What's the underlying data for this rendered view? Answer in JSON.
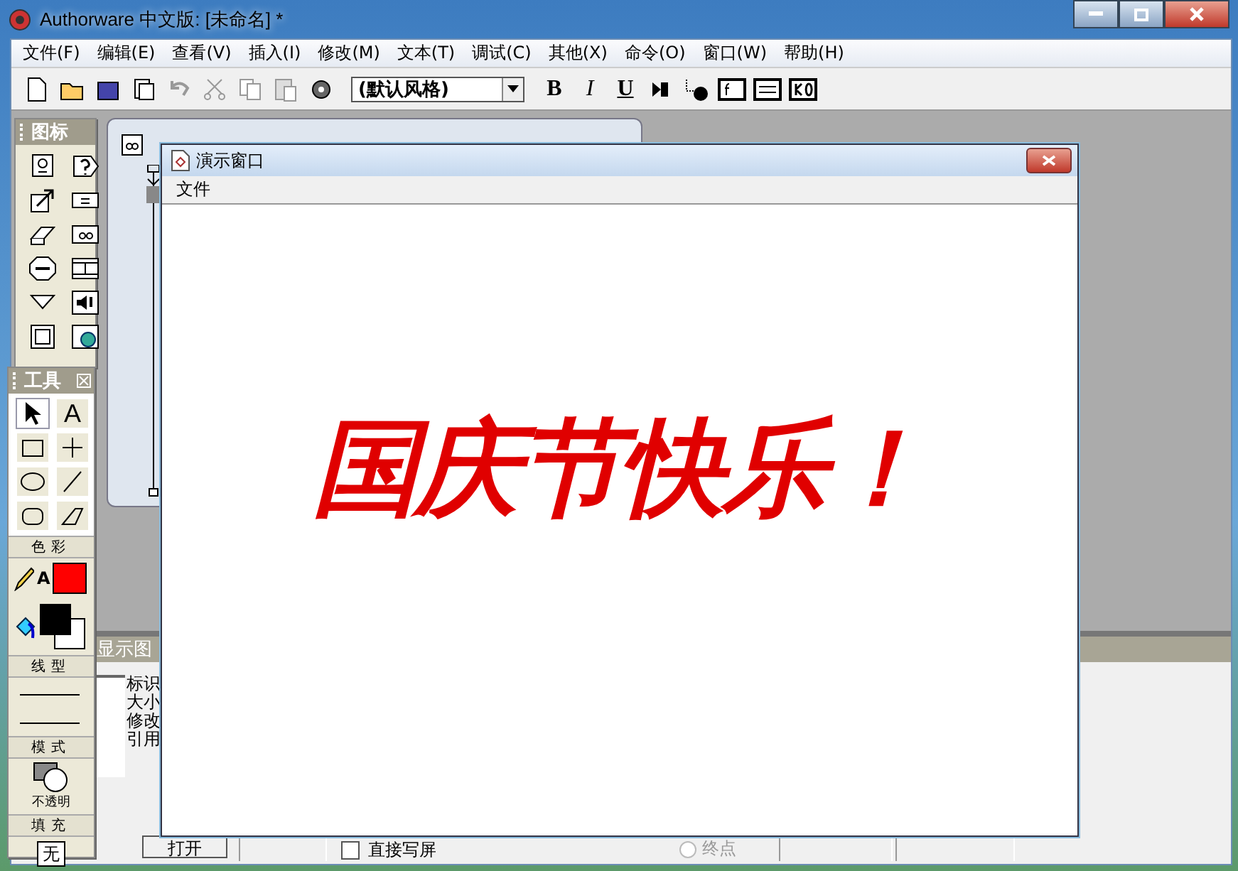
{
  "app_window": {
    "title": "Authorware 中文版: [未命名] *"
  },
  "menu": [
    "文件(F)",
    "编辑(E)",
    "查看(V)",
    "插入(I)",
    "修改(M)",
    "文本(T)",
    "调试(C)",
    "其他(X)",
    "命令(O)",
    "窗口(W)",
    "帮助(H)"
  ],
  "toolbar": {
    "style_dropdown": "(默认风格)",
    "format_buttons": [
      "B",
      "I",
      "U"
    ]
  },
  "icon_palette": {
    "title": "图标"
  },
  "tools_palette": {
    "title": "工具",
    "tools": [
      {
        "kind": "pointer",
        "selected": true
      },
      {
        "kind": "text",
        "glyph": "A",
        "selected": false
      },
      {
        "kind": "rectangle",
        "selected": false
      },
      {
        "kind": "cross",
        "selected": false
      },
      {
        "kind": "ellipse",
        "selected": false
      },
      {
        "kind": "line",
        "selected": false
      },
      {
        "kind": "rounded",
        "selected": false
      },
      {
        "kind": "polygon",
        "selected": false
      }
    ],
    "color_section": "色彩",
    "text_color_glyph": "A",
    "line_section": "线型",
    "mode_section": "模式",
    "mode_label": "不透明",
    "fill_section": "填充",
    "fill_value": "无"
  },
  "properties_panel": {
    "title": "显示图",
    "fields": [
      "标识",
      "大小",
      "修改",
      "引用"
    ],
    "open_button": "打开",
    "direct_write": {
      "label": "直接写屏",
      "checked": false
    },
    "endpoint": {
      "label": "终点",
      "disabled": true
    }
  },
  "presentation_window": {
    "title": "演示窗口",
    "menu": [
      "文件"
    ],
    "text": "国庆节快乐！"
  }
}
